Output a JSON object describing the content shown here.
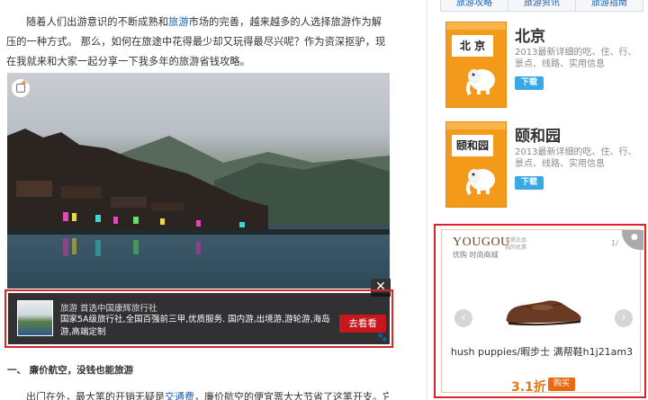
{
  "article": {
    "para1_a": "随着人们出游意识的不断成熟和",
    "para1_link": "旅游",
    "para1_b": "市场的完善，越来越多的人选择旅游作为解压的一种方式。 那么，如何在旅途中花得最少却又玩得最尽兴呢？作为资深抠驴，现在我就来和大家一起分享一下我多年的旅游省钱攻略。",
    "heading": "一、 廉价航空，没钱也能旅游",
    "para2_a": "出门在外，最大笔的开销无疑是",
    "para2_link": "交通费",
    "para2_b": "，廉价航空的便宜票大大节省了这笔开支。它为"
  },
  "photo_ad": {
    "source": "旅游 首选中国康辉旅行社",
    "description": "国家5A级旅行社,全国百强前三甲,优质服务. 国内游,出境游,游轮游,海岛游,高端定制",
    "cta": "去看看",
    "close": "✕",
    "paw": "🐾"
  },
  "sidebar": {
    "tabs": [
      "旅游攻略",
      "旅游资讯",
      "旅游指南"
    ],
    "guides": [
      {
        "cover_label": "北 京",
        "title": "北京",
        "subtitle": "2013最新详细的吃、住、行、景点、线路、实用信息",
        "download": "下载"
      },
      {
        "cover_label": "颐和园",
        "title": "颐和园",
        "subtitle": "2013最新详细的吃、住、行、景点、线路、实用信息",
        "download": "下载"
      }
    ],
    "ad": {
      "logo_en": "YOUGOU",
      "logo_cn": "优购 时尚商城",
      "tagline": "优质正品 我的优惠",
      "page_indicator": "1/",
      "product_name": "hush puppies/暇步士 满帮鞋h1j21am3",
      "discount": "3.1折",
      "buy": "购买",
      "prev": "‹",
      "next": "›"
    }
  },
  "colors": {
    "accent_red": "#d9242a",
    "link_blue": "#1a5fb4",
    "guide_orange": "#f39a1a",
    "download_blue": "#3aa8e4",
    "discount_orange": "#e7770f"
  }
}
